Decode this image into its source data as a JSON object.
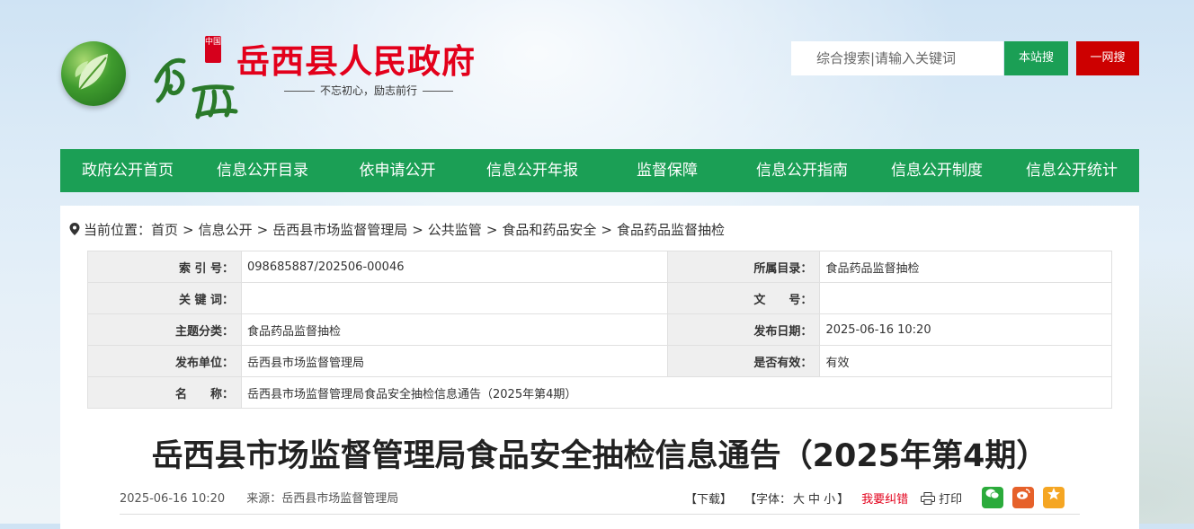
{
  "header": {
    "seal_text": "中国",
    "calligraphy": "岳西",
    "site_title": "岳西县人民政府",
    "slogan": "不忘初心，励志前行"
  },
  "search": {
    "placeholder": "综合搜索|请输入关键词",
    "site_search_label": "本站搜",
    "web_search_label": "一网搜"
  },
  "nav": {
    "items": [
      {
        "label": "政府公开首页"
      },
      {
        "label": "信息公开目录"
      },
      {
        "label": "依申请公开"
      },
      {
        "label": "信息公开年报"
      },
      {
        "label": "监督保障"
      },
      {
        "label": "信息公开指南"
      },
      {
        "label": "信息公开制度"
      },
      {
        "label": "信息公开统计"
      }
    ]
  },
  "breadcrumb": {
    "prefix": "当前位置：",
    "items": [
      "首页",
      "信息公开",
      "岳西县市场监督管理局",
      "公共监管",
      "食品和药品安全",
      "食品药品监督抽检"
    ],
    "separator": ">"
  },
  "meta": {
    "index_label": "索 引 号：",
    "index_value": "098685887/202506-00046",
    "catalog_label": "所属目录：",
    "catalog_value": "食品药品监督抽检",
    "keyword_label": "关 键 词：",
    "keyword_value": "",
    "doc_no_label": "文　　号：",
    "doc_no_value": "",
    "topic_label": "主题分类：",
    "topic_value": "食品药品监督抽检",
    "date_label": "发布日期：",
    "date_value": "2025-06-16 10:20",
    "unit_label": "发布单位：",
    "unit_value": "岳西县市场监督管理局",
    "valid_label": "是否有效：",
    "valid_value": "有效",
    "name_label": "名　　称：",
    "name_value": "岳西县市场监督管理局食品安全抽检信息通告（2025年第4期）"
  },
  "article": {
    "title": "岳西县市场监督管理局食品安全抽检信息通告（2025年第4期）",
    "date": "2025-06-16 10:20",
    "source": "来源：岳西县市场监督管理局"
  },
  "tools": {
    "download": "【下载】",
    "font_prefix": "【字体：",
    "font_large": "大",
    "font_medium": "中",
    "font_small": "小",
    "font_suffix": "】",
    "correction": "我要纠错",
    "print": "打印"
  },
  "colors": {
    "primary_green": "#1b9f55",
    "brand_red": "#e3001b",
    "search_red": "#cd0000"
  }
}
